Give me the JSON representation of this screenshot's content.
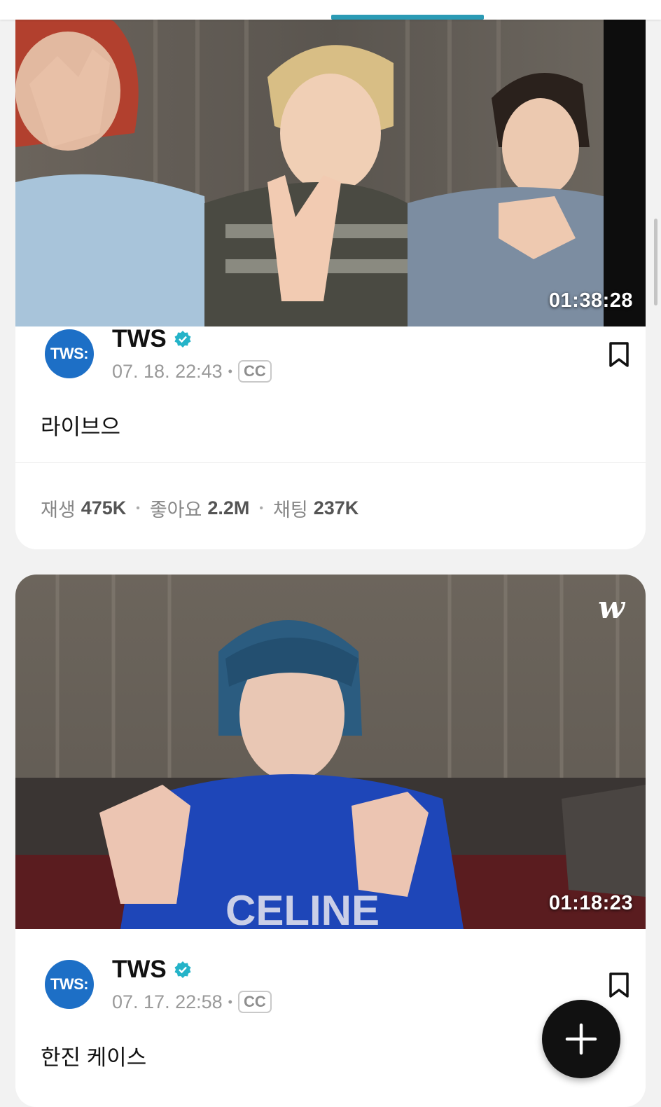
{
  "app": {
    "accent": "#2b9bb5",
    "avatar_color": "#1d6fc6",
    "verified_color": "#24b3c8"
  },
  "posts": [
    {
      "author": "TWS",
      "avatar_text": "TWS:",
      "verified": true,
      "date": "07. 18. 22:43",
      "cc": "CC",
      "title": "라이브으",
      "duration": "01:38:28",
      "stats": {
        "play_label": "재생",
        "play": "475K",
        "like_label": "좋아요",
        "like": "2.2M",
        "chat_label": "채팅",
        "chat": "237K"
      }
    },
    {
      "author": "TWS",
      "avatar_text": "TWS:",
      "verified": true,
      "date": "07. 17. 22:58",
      "cc": "CC",
      "title": "한진 케이스",
      "duration": "01:18:23",
      "logo": "w"
    }
  ],
  "icons": [
    "verified-badge-icon",
    "bookmark-icon",
    "plus-icon",
    "weverse-logo-icon"
  ]
}
